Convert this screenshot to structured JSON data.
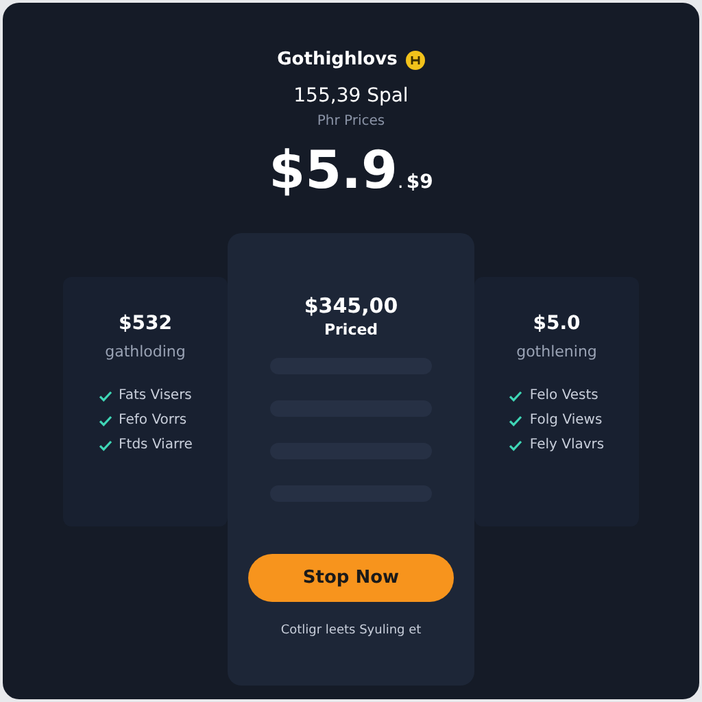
{
  "header": {
    "brand": "Gothighlovs",
    "headline": "155,39 Spal",
    "subtitle": "Phr Prices",
    "price_main": "$5.9",
    "price_suffix": ".",
    "price_small": "$9"
  },
  "plans": [
    {
      "kind": "side",
      "price": "$532",
      "name": "gathloding",
      "features": [
        "Fats Visers",
        "Fefo Vorrs",
        "Ftds Viarre"
      ]
    },
    {
      "kind": "featured",
      "price": "$345,00",
      "name": "Priced",
      "button": "Stop Now",
      "footnote": "Cotligr leets Syuling et"
    },
    {
      "kind": "side",
      "price": "$5.0",
      "name": "gothlening",
      "features": [
        "Felo Vests",
        "Folg Views",
        "Fely Vlavrs"
      ]
    }
  ]
}
